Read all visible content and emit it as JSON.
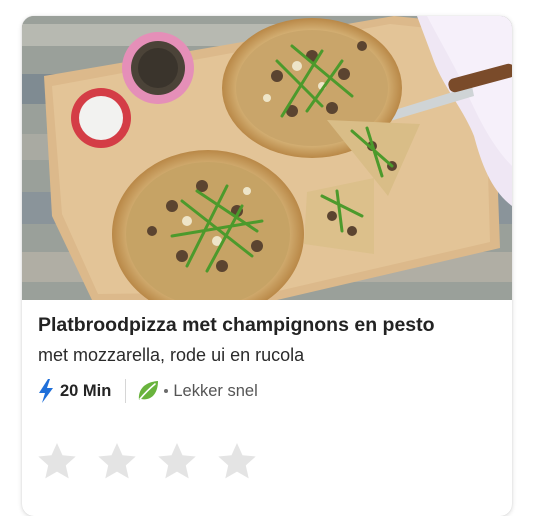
{
  "recipe": {
    "title": "Platbroodpizza met champignons en pesto",
    "subtitle": "met mozzarella, rode ui en rucola",
    "time": "20 Min",
    "tag": "Lekker snel",
    "icons": {
      "time": "lightning-bolt-icon",
      "tag": "leaf-icon"
    }
  },
  "rating": {
    "max": 5,
    "visible_stars": 4,
    "value": 0
  },
  "colors": {
    "bolt": "#1f6fd9",
    "leaf": "#69b33d",
    "star_empty": "#e4e4e4"
  }
}
